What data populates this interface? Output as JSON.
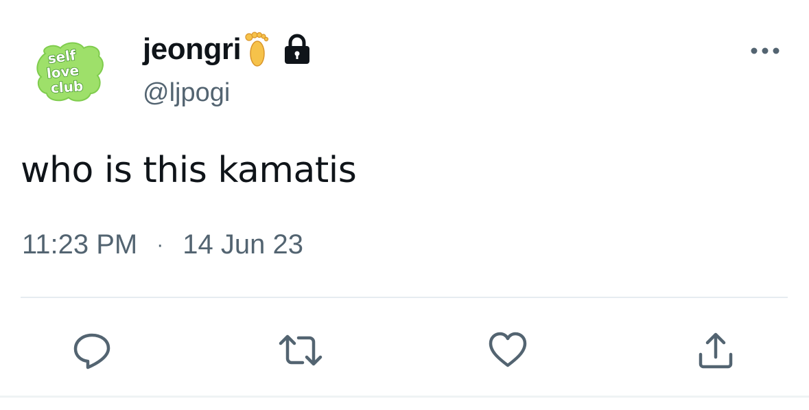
{
  "author": {
    "display_name": "jeongri",
    "handle": "@ljpogi",
    "avatar_text": "self love club",
    "badge_icons": [
      "foot-emoji-icon",
      "lock-icon"
    ]
  },
  "tweet": {
    "text": "who is this kamatis",
    "time": "11:23 PM",
    "separator": "·",
    "date": "14 Jun 23"
  },
  "actions": [
    {
      "name": "reply",
      "icon": "reply-icon"
    },
    {
      "name": "retweet",
      "icon": "retweet-icon"
    },
    {
      "name": "like",
      "icon": "heart-icon"
    },
    {
      "name": "share",
      "icon": "share-icon"
    }
  ],
  "colors": {
    "text_primary": "#0f1419",
    "text_secondary": "#536471",
    "divider": "#e6ecf0",
    "avatar_green": "#9ee06a",
    "avatar_green_dark": "#3f8f2a"
  }
}
